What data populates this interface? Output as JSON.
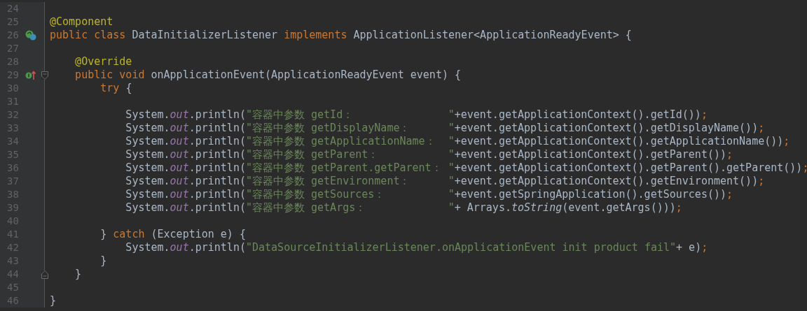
{
  "editor": {
    "lines": [
      {
        "number": "24"
      },
      {
        "number": "25",
        "tokens": [
          {
            "kind": "annotation",
            "text": "@Component"
          }
        ]
      },
      {
        "number": "26",
        "gutter_icon": {
          "kind": "implementing"
        },
        "tokens": [
          {
            "kind": "keyword",
            "text": "public class "
          },
          {
            "kind": "plain",
            "text": "DataInitializerListener "
          },
          {
            "kind": "keyword",
            "text": "implements "
          },
          {
            "kind": "plain",
            "text": "ApplicationListener<ApplicationReadyEvent> {"
          }
        ]
      },
      {
        "number": "27"
      },
      {
        "number": "28",
        "tokens": [
          {
            "kind": "annotation",
            "text": "    @Override"
          }
        ]
      },
      {
        "number": "29",
        "gutter_icon": {
          "kind": "overriding"
        },
        "fold_marker": {
          "kind": "start"
        },
        "tokens": [
          {
            "kind": "keyword",
            "text": "    public void "
          },
          {
            "kind": "plain",
            "text": "onApplicationEvent(ApplicationReadyEvent event) {"
          }
        ]
      },
      {
        "number": "30",
        "tokens": [
          {
            "kind": "keyword",
            "text": "        try "
          },
          {
            "kind": "plain",
            "text": "{"
          }
        ]
      },
      {
        "number": "31"
      },
      {
        "number": "32",
        "tokens": [
          {
            "kind": "plain",
            "text": "            System."
          },
          {
            "kind": "field",
            "text": "out"
          },
          {
            "kind": "plain",
            "text": ".println("
          },
          {
            "kind": "string",
            "text": "\"容器中参数 getId：               \""
          },
          {
            "kind": "plain",
            "text": "+event.getApplicationContext().getId())"
          },
          {
            "kind": "keyword",
            "text": ";"
          }
        ]
      },
      {
        "number": "33",
        "tokens": [
          {
            "kind": "plain",
            "text": "            System."
          },
          {
            "kind": "field",
            "text": "out"
          },
          {
            "kind": "plain",
            "text": ".println("
          },
          {
            "kind": "string",
            "text": "\"容器中参数 getDisplayName：      \""
          },
          {
            "kind": "plain",
            "text": "+event.getApplicationContext().getDisplayName())"
          },
          {
            "kind": "keyword",
            "text": ";"
          }
        ]
      },
      {
        "number": "34",
        "tokens": [
          {
            "kind": "plain",
            "text": "            System."
          },
          {
            "kind": "field",
            "text": "out"
          },
          {
            "kind": "plain",
            "text": ".println("
          },
          {
            "kind": "string",
            "text": "\"容器中参数 getApplicationName：  \""
          },
          {
            "kind": "plain",
            "text": "+event.getApplicationContext().getApplicationName())"
          },
          {
            "kind": "keyword",
            "text": ";"
          }
        ]
      },
      {
        "number": "35",
        "tokens": [
          {
            "kind": "plain",
            "text": "            System."
          },
          {
            "kind": "field",
            "text": "out"
          },
          {
            "kind": "plain",
            "text": ".println("
          },
          {
            "kind": "string",
            "text": "\"容器中参数 getParent：           \""
          },
          {
            "kind": "plain",
            "text": "+event.getApplicationContext().getParent())"
          },
          {
            "kind": "keyword",
            "text": ";"
          }
        ]
      },
      {
        "number": "36",
        "tokens": [
          {
            "kind": "plain",
            "text": "            System."
          },
          {
            "kind": "field",
            "text": "out"
          },
          {
            "kind": "plain",
            "text": ".println("
          },
          {
            "kind": "string",
            "text": "\"容器中参数 getParent.getParent： \""
          },
          {
            "kind": "plain",
            "text": "+event.getApplicationContext().getParent().getParent())"
          },
          {
            "kind": "keyword",
            "text": ";"
          }
        ]
      },
      {
        "number": "37",
        "tokens": [
          {
            "kind": "plain",
            "text": "            System."
          },
          {
            "kind": "field",
            "text": "out"
          },
          {
            "kind": "plain",
            "text": ".println("
          },
          {
            "kind": "string",
            "text": "\"容器中参数 getEnvironment：      \""
          },
          {
            "kind": "plain",
            "text": "+event.getApplicationContext().getEnvironment())"
          },
          {
            "kind": "keyword",
            "text": ";"
          }
        ]
      },
      {
        "number": "38",
        "tokens": [
          {
            "kind": "plain",
            "text": "            System."
          },
          {
            "kind": "field",
            "text": "out"
          },
          {
            "kind": "plain",
            "text": ".println("
          },
          {
            "kind": "string",
            "text": "\"容器中参数 getSources：          \""
          },
          {
            "kind": "plain",
            "text": "+event.getSpringApplication().getSources())"
          },
          {
            "kind": "keyword",
            "text": ";"
          }
        ]
      },
      {
        "number": "39",
        "tokens": [
          {
            "kind": "plain",
            "text": "            System."
          },
          {
            "kind": "field",
            "text": "out"
          },
          {
            "kind": "plain",
            "text": ".println("
          },
          {
            "kind": "string",
            "text": "\"容器中参数 getArgs：             \""
          },
          {
            "kind": "plain",
            "text": "+ Arrays."
          },
          {
            "kind": "static",
            "text": "toString"
          },
          {
            "kind": "plain",
            "text": "(event.getArgs()))"
          },
          {
            "kind": "keyword",
            "text": ";"
          }
        ]
      },
      {
        "number": "40"
      },
      {
        "number": "41",
        "tokens": [
          {
            "kind": "plain",
            "text": "        } "
          },
          {
            "kind": "keyword",
            "text": "catch "
          },
          {
            "kind": "plain",
            "text": "(Exception e) {"
          }
        ]
      },
      {
        "number": "42",
        "tokens": [
          {
            "kind": "plain",
            "text": "            System."
          },
          {
            "kind": "field",
            "text": "out"
          },
          {
            "kind": "plain",
            "text": ".println("
          },
          {
            "kind": "string",
            "text": "\"DataSourceInitializerListener.onApplicationEvent init product fail\""
          },
          {
            "kind": "plain",
            "text": "+ e)"
          },
          {
            "kind": "keyword",
            "text": ";"
          }
        ]
      },
      {
        "number": "43",
        "tokens": [
          {
            "kind": "plain",
            "text": "        }"
          }
        ]
      },
      {
        "number": "44",
        "fold_marker": {
          "kind": "end"
        },
        "tokens": [
          {
            "kind": "plain",
            "text": "    }"
          }
        ]
      },
      {
        "number": "45"
      },
      {
        "number": "46",
        "tokens": [
          {
            "kind": "plain",
            "text": "}"
          }
        ]
      }
    ]
  }
}
